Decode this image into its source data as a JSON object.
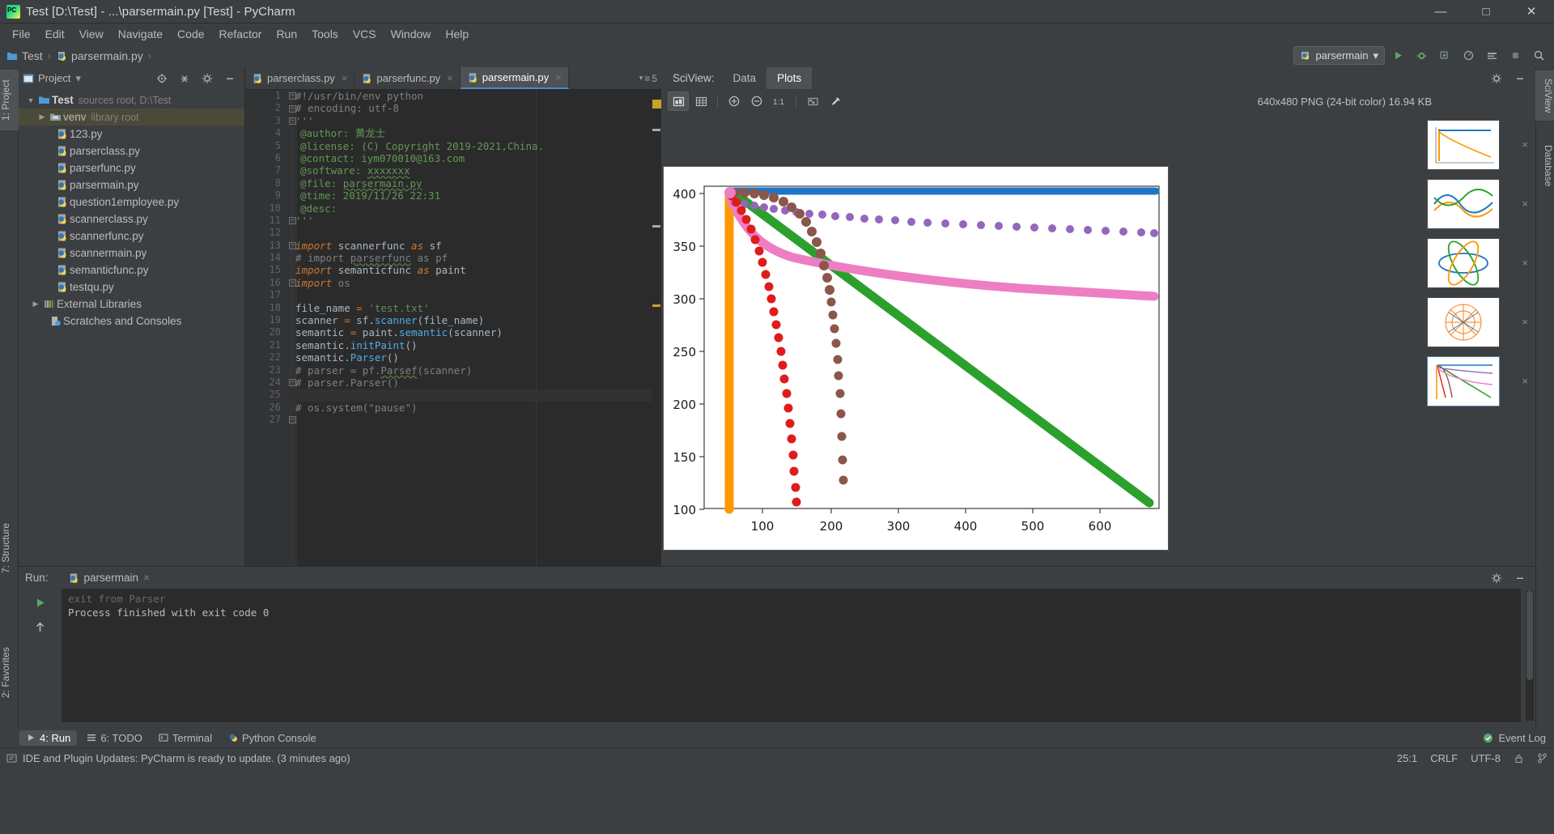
{
  "window": {
    "title": "Test [D:\\Test] - ...\\parsermain.py [Test] - PyCharm",
    "minimize": "—",
    "maximize": "□",
    "close": "✕"
  },
  "menu": [
    "File",
    "Edit",
    "View",
    "Navigate",
    "Code",
    "Refactor",
    "Run",
    "Tools",
    "VCS",
    "Window",
    "Help"
  ],
  "breadcrumb": {
    "project": "Test",
    "file": "parsermain.py",
    "separator": "›"
  },
  "toolbar": {
    "run_config": "parsermain",
    "run_config_caret": "▾",
    "buttons": [
      "run-button",
      "debug-button",
      "run-coverage-button",
      "profile-button",
      "attach-button",
      "stop-button",
      "search-button"
    ]
  },
  "left_strip": {
    "tabs": [
      "1: Project",
      "7: Structure",
      "2: Favorites"
    ]
  },
  "right_strip": {
    "tabs": [
      "SciView",
      "Database"
    ]
  },
  "project": {
    "title": "Project",
    "caret": "▾",
    "tools": [
      "locate-icon",
      "collapse-all-icon",
      "settings-icon",
      "hide-icon"
    ],
    "tree": [
      {
        "indent": 0,
        "arrow": "▼",
        "icon": "folder-module",
        "label": "Test",
        "bold": true,
        "hint": "sources root, D:\\Test",
        "selected": false
      },
      {
        "indent": 1,
        "arrow": "▶",
        "icon": "folder-library",
        "label": "venv",
        "bold": false,
        "hint": "library root",
        "selected": true
      },
      {
        "indent": 2,
        "arrow": "",
        "icon": "python-file",
        "label": "123.py",
        "bold": false,
        "hint": "",
        "selected": false
      },
      {
        "indent": 2,
        "arrow": "",
        "icon": "python-file",
        "label": "parserclass.py",
        "bold": false,
        "hint": "",
        "selected": false
      },
      {
        "indent": 2,
        "arrow": "",
        "icon": "python-file",
        "label": "parserfunc.py",
        "bold": false,
        "hint": "",
        "selected": false
      },
      {
        "indent": 2,
        "arrow": "",
        "icon": "python-file",
        "label": "parsermain.py",
        "bold": false,
        "hint": "",
        "selected": false
      },
      {
        "indent": 2,
        "arrow": "",
        "icon": "python-file",
        "label": "question1employee.py",
        "bold": false,
        "hint": "",
        "selected": false
      },
      {
        "indent": 2,
        "arrow": "",
        "icon": "python-file",
        "label": "scannerclass.py",
        "bold": false,
        "hint": "",
        "selected": false
      },
      {
        "indent": 2,
        "arrow": "",
        "icon": "python-file",
        "label": "scannerfunc.py",
        "bold": false,
        "hint": "",
        "selected": false
      },
      {
        "indent": 2,
        "arrow": "",
        "icon": "python-file",
        "label": "scannermain.py",
        "bold": false,
        "hint": "",
        "selected": false
      },
      {
        "indent": 2,
        "arrow": "",
        "icon": "python-file",
        "label": "semanticfunc.py",
        "bold": false,
        "hint": "",
        "selected": false
      },
      {
        "indent": 2,
        "arrow": "",
        "icon": "python-file",
        "label": "testqu.py",
        "bold": false,
        "hint": "",
        "selected": false
      },
      {
        "indent": 0,
        "arrow": "▶",
        "icon": "libraries",
        "label": "External Libraries",
        "bold": false,
        "hint": "",
        "selected": false
      },
      {
        "indent": 1,
        "arrow": "",
        "icon": "scratches",
        "label": "Scratches and Consoles",
        "bold": false,
        "hint": "",
        "selected": false
      }
    ]
  },
  "editor": {
    "tabs": [
      {
        "label": "parserclass.py",
        "active": false
      },
      {
        "label": "parserfunc.py",
        "active": false
      },
      {
        "label": "parsermain.py",
        "active": true
      }
    ],
    "tab_close": "×",
    "tab_count": "5",
    "current_line": 25,
    "lines": [
      {
        "n": 1,
        "fold": "∓",
        "segs": [
          {
            "t": "#!/usr/bin/env python",
            "c": "tok-cmt"
          }
        ]
      },
      {
        "n": 2,
        "fold": "⊔",
        "segs": [
          {
            "t": "# encoding: utf-8",
            "c": "tok-cmt"
          }
        ]
      },
      {
        "n": 3,
        "fold": "∓",
        "segs": [
          {
            "t": "'''",
            "c": "tok-doc"
          }
        ]
      },
      {
        "n": 4,
        "fold": "",
        "segs": [
          {
            "t": "@author: 黄龙士",
            "c": "tok-doc"
          }
        ]
      },
      {
        "n": 5,
        "fold": "",
        "segs": [
          {
            "t": "@license: (C) Copyright 2019-2021,China.",
            "c": "tok-doc"
          }
        ]
      },
      {
        "n": 6,
        "fold": "",
        "segs": [
          {
            "t": "@contact: iym070010@163.com",
            "c": "tok-doc"
          }
        ]
      },
      {
        "n": 7,
        "fold": "",
        "segs": [
          {
            "t": "@software: ",
            "c": "tok-doc"
          },
          {
            "t": "xxxxxxx",
            "c": "tok-doc typo"
          }
        ]
      },
      {
        "n": 8,
        "fold": "",
        "segs": [
          {
            "t": "@file: ",
            "c": "tok-doc"
          },
          {
            "t": "parsermain.py",
            "c": "tok-doc typo"
          }
        ]
      },
      {
        "n": 9,
        "fold": "",
        "segs": [
          {
            "t": "@time: 2019/11/26 22:31",
            "c": "tok-doc"
          }
        ]
      },
      {
        "n": 10,
        "fold": "",
        "segs": [
          {
            "t": "@desc:",
            "c": "tok-doc"
          }
        ]
      },
      {
        "n": 11,
        "fold": "⊔",
        "segs": [
          {
            "t": "'''",
            "c": "tok-doc"
          }
        ]
      },
      {
        "n": 12,
        "fold": "",
        "segs": []
      },
      {
        "n": 13,
        "fold": "∓",
        "segs": [
          {
            "t": "import",
            "c": "tok-kw"
          },
          {
            "t": " scannerfunc ",
            "c": "tok-txt"
          },
          {
            "t": "as",
            "c": "tok-kw"
          },
          {
            "t": " sf",
            "c": "tok-txt"
          }
        ]
      },
      {
        "n": 14,
        "fold": "",
        "segs": [
          {
            "t": "# import ",
            "c": "tok-cmt"
          },
          {
            "t": "parserfunc",
            "c": "tok-cmt typo"
          },
          {
            "t": " as pf",
            "c": "tok-cmt"
          }
        ]
      },
      {
        "n": 15,
        "fold": "",
        "segs": [
          {
            "t": "import",
            "c": "tok-kw"
          },
          {
            "t": " semanticfunc ",
            "c": "tok-txt"
          },
          {
            "t": "as",
            "c": "tok-kw"
          },
          {
            "t": " paint",
            "c": "tok-txt"
          }
        ]
      },
      {
        "n": 16,
        "fold": "⊔",
        "segs": [
          {
            "t": "import",
            "c": "tok-kw"
          },
          {
            "t": " os",
            "c": "tok-cmt"
          }
        ]
      },
      {
        "n": 17,
        "fold": "",
        "segs": []
      },
      {
        "n": 18,
        "fold": "",
        "segs": [
          {
            "t": "file_name ",
            "c": "tok-txt"
          },
          {
            "t": "=",
            "c": "tok-kw2"
          },
          {
            "t": " ",
            "c": "tok-txt"
          },
          {
            "t": "'test.txt'",
            "c": "tok-str"
          }
        ]
      },
      {
        "n": 19,
        "fold": "",
        "segs": [
          {
            "t": "scanner ",
            "c": "tok-txt"
          },
          {
            "t": "=",
            "c": "tok-kw2"
          },
          {
            "t": " sf.",
            "c": "tok-txt"
          },
          {
            "t": "scanner",
            "c": "tok-cyan"
          },
          {
            "t": "(file_name)",
            "c": "tok-txt"
          }
        ]
      },
      {
        "n": 20,
        "fold": "",
        "segs": [
          {
            "t": "semantic ",
            "c": "tok-txt"
          },
          {
            "t": "=",
            "c": "tok-kw2"
          },
          {
            "t": " paint.",
            "c": "tok-txt"
          },
          {
            "t": "semantic",
            "c": "tok-cyan"
          },
          {
            "t": "(scanner)",
            "c": "tok-txt"
          }
        ]
      },
      {
        "n": 21,
        "fold": "",
        "segs": [
          {
            "t": "semantic.",
            "c": "tok-txt"
          },
          {
            "t": "initPaint",
            "c": "tok-cyan"
          },
          {
            "t": "()",
            "c": "tok-txt"
          }
        ]
      },
      {
        "n": 22,
        "fold": "",
        "segs": [
          {
            "t": "semantic.",
            "c": "tok-txt"
          },
          {
            "t": "Parser",
            "c": "tok-cyan"
          },
          {
            "t": "()",
            "c": "tok-txt"
          }
        ]
      },
      {
        "n": 23,
        "fold": "⊔",
        "segs": [
          {
            "t": "# parser = pf.",
            "c": "tok-cmt"
          },
          {
            "t": "Parsef",
            "c": "tok-cmt typo"
          },
          {
            "t": "(scanner)",
            "c": "tok-cmt"
          }
        ]
      },
      {
        "n": 24,
        "fold": "",
        "segs": [
          {
            "t": "# parser.Parser()",
            "c": "tok-cmt"
          }
        ]
      },
      {
        "n": 25,
        "fold": "",
        "segs": []
      },
      {
        "n": 26,
        "fold": "⊔",
        "segs": [
          {
            "t": "# os.system(\"pause\")",
            "c": "tok-cmt"
          }
        ]
      },
      {
        "n": 27,
        "fold": "",
        "segs": []
      }
    ]
  },
  "sciview": {
    "title": "SciView:",
    "tabs": [
      {
        "label": "Data",
        "active": false
      },
      {
        "label": "Plots",
        "active": true
      }
    ],
    "image_info": "640x480 PNG (24-bit color) 16.94 KB",
    "toolbar_buttons": [
      "fit-to-window-icon",
      "actual-grid-icon",
      "zoom-in-icon",
      "zoom-out-icon",
      "zoom-reset-icon",
      "transparency-icon",
      "color-picker-icon"
    ],
    "settings_icon": "gear-icon",
    "hide_icon": "hide-icon",
    "thumbnail_close": "×",
    "thumbnails": [
      {
        "name": "plot-thumbnail-1",
        "selected": false
      },
      {
        "name": "plot-thumbnail-2",
        "selected": false
      },
      {
        "name": "plot-thumbnail-3",
        "selected": false
      },
      {
        "name": "plot-thumbnail-4",
        "selected": false
      },
      {
        "name": "plot-thumbnail-5",
        "selected": true
      }
    ]
  },
  "chart_data": {
    "type": "line",
    "title": "",
    "xlabel": "",
    "ylabel": "",
    "xlim": [
      40,
      680
    ],
    "ylim": [
      90,
      412
    ],
    "xticks": [
      100,
      200,
      300,
      400,
      500,
      600
    ],
    "yticks": [
      100,
      150,
      200,
      250,
      300,
      350,
      400
    ],
    "grid": false,
    "legend": "none",
    "series": [
      {
        "name": "blue-flat",
        "color": "#1f77c4",
        "style": "thick-line",
        "x": [
          55,
          120,
          200,
          300,
          400,
          500,
          600,
          660
        ],
        "y": [
          400,
          400,
          400,
          400,
          400,
          400,
          400,
          400
        ]
      },
      {
        "name": "orange-vertical",
        "color": "#ff9800",
        "style": "thick-line",
        "x": [
          53,
          53,
          53,
          53,
          53
        ],
        "y": [
          400,
          320,
          240,
          160,
          100
        ]
      },
      {
        "name": "green-linear",
        "color": "#2ca02c",
        "style": "thick-line",
        "x": [
          58,
          160,
          260,
          360,
          460,
          560,
          655
        ],
        "y": [
          400,
          345,
          295,
          245,
          195,
          145,
          100
        ]
      },
      {
        "name": "red-steep",
        "color": "#e01b1b",
        "style": "dots",
        "x": [
          60,
          80,
          100,
          120,
          135,
          148,
          158,
          165,
          170
        ],
        "y": [
          398,
          360,
          320,
          270,
          225,
          185,
          150,
          120,
          103
        ]
      },
      {
        "name": "brown-knee",
        "color": "#8c564b",
        "style": "dots",
        "x": [
          60,
          90,
          130,
          170,
          195,
          205,
          208,
          210,
          212
        ],
        "y": [
          400,
          398,
          392,
          370,
          330,
          280,
          215,
          160,
          130
        ]
      },
      {
        "name": "purple-slow",
        "color": "#9467bd",
        "style": "dots",
        "x": [
          60,
          120,
          200,
          300,
          400,
          500,
          600,
          655
        ],
        "y": [
          395,
          388,
          382,
          377,
          373,
          369,
          365,
          362
        ]
      },
      {
        "name": "pink-decay",
        "color": "#ee7ec4",
        "style": "thick-line",
        "x": [
          55,
          90,
          140,
          200,
          280,
          380,
          480,
          580,
          655
        ],
        "y": [
          392,
          355,
          333,
          322,
          312,
          303,
          296,
          291,
          288
        ]
      }
    ]
  },
  "run": {
    "label": "Run:",
    "config_name": "parsermain",
    "close": "×",
    "console": [
      "exit from Parser",
      "",
      "Process finished with exit code 0"
    ],
    "tools": [
      "settings-icon",
      "hide-icon"
    ],
    "side_buttons": [
      "rerun-button",
      "scroll-up-button"
    ]
  },
  "bottom_tabs": [
    {
      "label": "4: Run",
      "icon": "run-icon",
      "active": true
    },
    {
      "label": "6: TODO",
      "icon": "todo-icon",
      "active": false
    },
    {
      "label": "Terminal",
      "icon": "terminal-icon",
      "active": false
    },
    {
      "label": "Python Console",
      "icon": "python-icon",
      "active": false
    }
  ],
  "bottom_right": {
    "label": "Event Log",
    "icon": "event-log-icon"
  },
  "statusbar": {
    "message": "IDE and Plugin Updates: PyCharm is ready to update. (3 minutes ago)",
    "caret": "25:1",
    "line_sep": "CRLF",
    "encoding": "UTF-8",
    "lock_icon": "lock-icon",
    "branch_icon": "branch-icon"
  }
}
